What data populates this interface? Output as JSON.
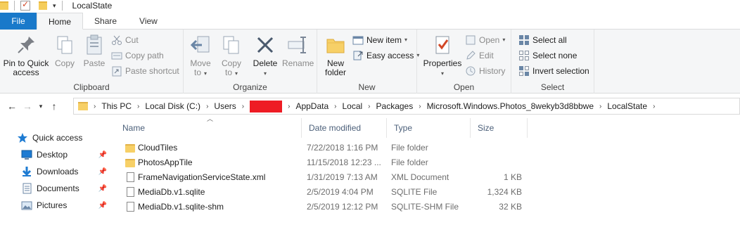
{
  "window": {
    "title": "LocalState"
  },
  "ribbon_tabs": [
    "File",
    "Home",
    "Share",
    "View"
  ],
  "ribbon": {
    "clipboard": {
      "label": "Clipboard",
      "pin_line1": "Pin to Quick",
      "pin_line2": "access",
      "copy": "Copy",
      "paste": "Paste",
      "cut": "Cut",
      "copy_path": "Copy path",
      "paste_shortcut": "Paste shortcut"
    },
    "organize": {
      "label": "Organize",
      "move_to_1": "Move",
      "move_to_2": "to",
      "copy_to_1": "Copy",
      "copy_to_2": "to",
      "delete": "Delete",
      "rename": "Rename"
    },
    "new": {
      "label": "New",
      "new_folder_1": "New",
      "new_folder_2": "folder",
      "new_item": "New item",
      "easy_access": "Easy access"
    },
    "open": {
      "label": "Open",
      "properties": "Properties",
      "open": "Open",
      "edit": "Edit",
      "history": "History"
    },
    "select": {
      "label": "Select",
      "select_all": "Select all",
      "select_none": "Select none",
      "invert_selection": "Invert selection"
    }
  },
  "address": {
    "crumbs": [
      "This PC",
      "Local Disk (C:)",
      "Users",
      "AppData",
      "Local",
      "Packages",
      "Microsoft.Windows.Photos_8wekyb3d8bbwe",
      "LocalState"
    ]
  },
  "nav_pane": {
    "items": [
      {
        "label": "Quick access",
        "icon": "star-icon"
      },
      {
        "label": "Desktop",
        "icon": "desktop-icon"
      },
      {
        "label": "Downloads",
        "icon": "download-arrow-icon"
      },
      {
        "label": "Documents",
        "icon": "documents-icon"
      },
      {
        "label": "Pictures",
        "icon": "pictures-icon"
      }
    ]
  },
  "file_list": {
    "columns": [
      "Name",
      "Date modified",
      "Type",
      "Size"
    ],
    "rows": [
      {
        "name": "CloudTiles",
        "date": "7/22/2018 1:16 PM",
        "type": "File folder",
        "size": "",
        "icon": "folder-icon"
      },
      {
        "name": "PhotosAppTile",
        "date": "11/15/2018 12:23 ...",
        "type": "File folder",
        "size": "",
        "icon": "folder-icon"
      },
      {
        "name": "FrameNavigationServiceState.xml",
        "date": "1/31/2019 7:13 AM",
        "type": "XML Document",
        "size": "1 KB",
        "icon": "file-icon"
      },
      {
        "name": "MediaDb.v1.sqlite",
        "date": "2/5/2019 4:04 PM",
        "type": "SQLITE File",
        "size": "1,324 KB",
        "icon": "file-icon"
      },
      {
        "name": "MediaDb.v1.sqlite-shm",
        "date": "2/5/2019 12:12 PM",
        "type": "SQLITE-SHM File",
        "size": "32 KB",
        "icon": "file-icon"
      }
    ]
  },
  "colors": {
    "file_tab": "#1979ca",
    "folder": "#f7d067",
    "redaction": "#ee1c24",
    "header_text": "#4c607a"
  }
}
